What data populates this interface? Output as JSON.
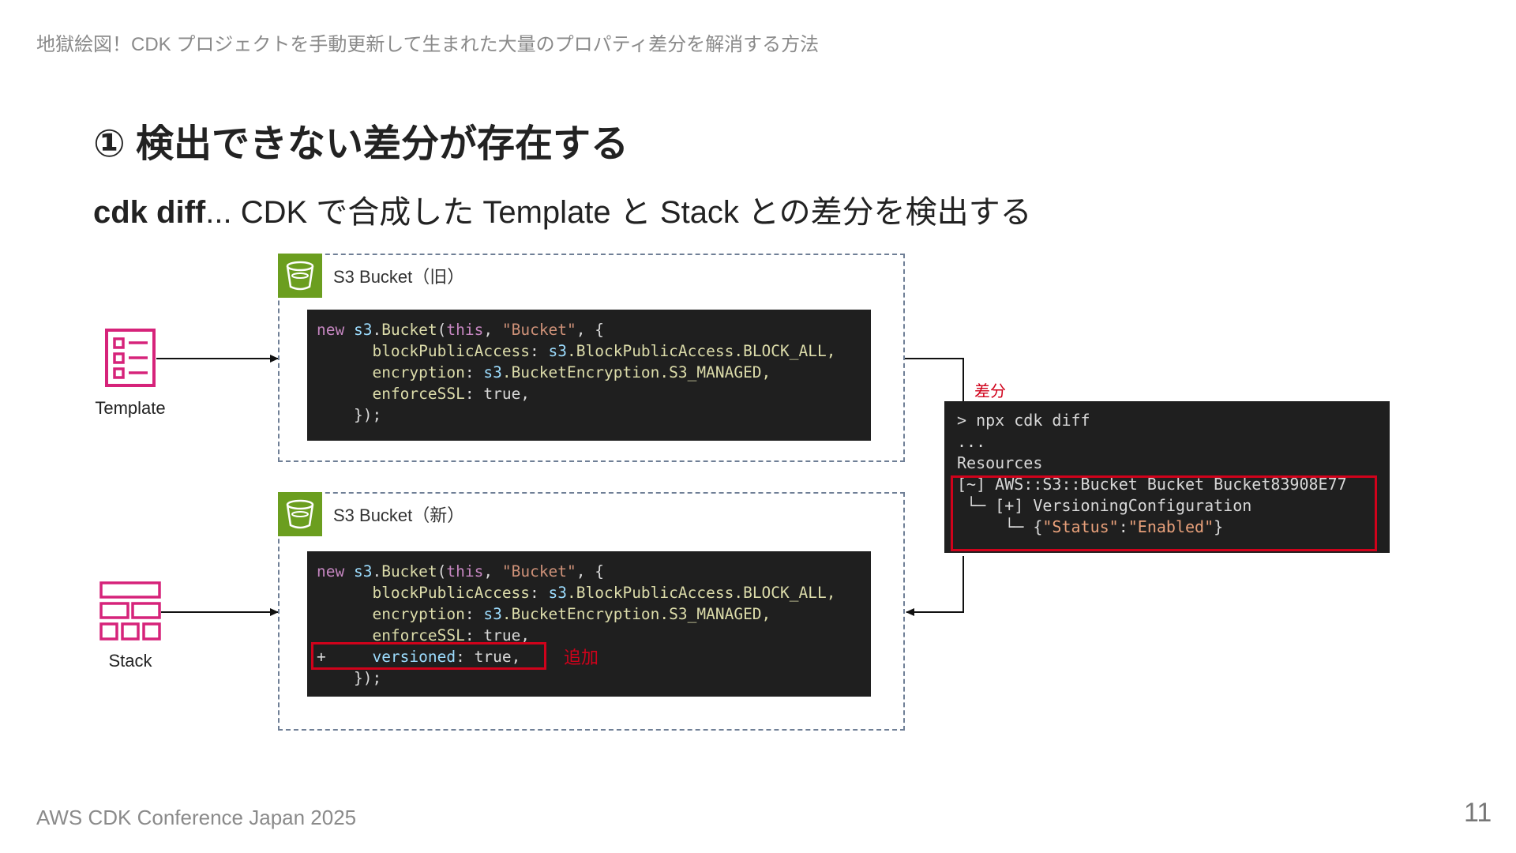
{
  "header": {
    "title": "地獄絵図！CDK プロジェクトを手動更新して生まれた大量のプロパティ差分を解消する方法"
  },
  "heading": "① 検出できない差分が存在する",
  "subheading": {
    "strong": "cdk diff",
    "rest": "... CDK で合成した Template と Stack との差分を検出する"
  },
  "template_icon": {
    "label": "Template"
  },
  "stack_icon": {
    "label": "Stack"
  },
  "old_bucket": {
    "label": "S3 Bucket（旧）",
    "code": {
      "l1": {
        "kw": "new ",
        "ns": "s3",
        "dot": ".",
        "fn": "Bucket",
        "open": "(",
        "this": "this",
        "comma": ", ",
        "str": "\"Bucket\"",
        "tail": ", {"
      },
      "l2": {
        "indent": "      ",
        "prop": "blockPublicAccess",
        "colon": ": ",
        "ns": "s3",
        "rest": ".BlockPublicAccess.BLOCK_ALL,"
      },
      "l3": {
        "indent": "      ",
        "prop": "encryption",
        "colon": ": ",
        "ns": "s3",
        "rest": ".BucketEncryption.S3_MANAGED,"
      },
      "l4": {
        "indent": "      ",
        "prop": "enforceSSL",
        "colon": ": ",
        "rest": "true,"
      },
      "l5": "    });"
    }
  },
  "new_bucket": {
    "label": "S3 Bucket（新）",
    "code": {
      "l1": {
        "kw": "new ",
        "ns": "s3",
        "dot": ".",
        "fn": "Bucket",
        "open": "(",
        "this": "this",
        "comma": ", ",
        "str": "\"Bucket\"",
        "tail": ", {"
      },
      "l2": {
        "indent": "      ",
        "prop": "blockPublicAccess",
        "colon": ": ",
        "ns": "s3",
        "rest": ".BlockPublicAccess.BLOCK_ALL,"
      },
      "l3": {
        "indent": "      ",
        "prop": "encryption",
        "colon": ": ",
        "ns": "s3",
        "rest": ".BucketEncryption.S3_MANAGED,"
      },
      "l4": {
        "indent": "      ",
        "prop": "enforceSSL",
        "colon": ": ",
        "rest": "true,"
      },
      "l5": {
        "plus": "+",
        "indent": "     ",
        "prop": "versioned",
        "colon": ": ",
        "rest": "true,"
      },
      "l6": "    });"
    },
    "added_label": "追加"
  },
  "diff": {
    "label": "差分",
    "terminal": {
      "l1": "> npx cdk diff",
      "l2": "...",
      "l3": "Resources",
      "l4": "[~] AWS::S3::Bucket Bucket Bucket83908E77",
      "l5": " └─ [+] VersioningConfiguration",
      "l6": {
        "prefix": "     └─ {",
        "k": "\"Status\"",
        "sep": ":",
        "v": "\"Enabled\"",
        "close": "}"
      }
    }
  },
  "footer": {
    "event": "AWS CDK Conference Japan 2025",
    "page": "11"
  },
  "colors": {
    "accent_red": "#d0021b",
    "s3_green": "#6b9e1f",
    "icon_pink": "#d6237a",
    "code_bg": "#1f1f1f"
  }
}
